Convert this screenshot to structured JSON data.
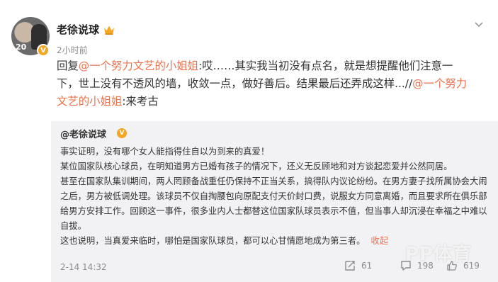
{
  "post": {
    "author": "老徐说球",
    "time": "2小时前",
    "reply_prefix": "回复",
    "mention1": "@一个努力文艺的小姐姐",
    "body_text": ":哎……其实我当初没有点名，就是想提醒他们注意一下，世上没有不透风的墙，收敛一点，做好善后。结果最后还弄成这样...//",
    "mention2": "@一个努力文艺的小姐姐",
    "body_tail": ":来考古"
  },
  "quoted": {
    "author": "@老徐说球",
    "paragraphs": [
      "事实证明，没有哪个女人能指得住自以为到来的真爱！",
      "某位国家队核心球员，在明知道男方已婚有孩子的情况下，还义无反顾地和对方谈起恋爱并公然同居。",
      "甚至在国家队集训期间，两人罔顾备战重任仍保持不正当关系，搞得队内议论纷纷。在男方妻子找所属协会大闹之后，男方被低调处理。该球员不仅自掏腰包向原配支付天价封口费，说服女方同意离婚，而且要求所在俱乐部给男方安排工作。回顾这一事件，很多业内人士都替这位国家队球员表示不值，但当事人却沉浸在幸福之中难以自拔。"
    ],
    "last_line": "这也说明，当真爱来临时，哪怕是国家队球员，都可以心甘情愿地成为第三者。",
    "collapse_label": "收起",
    "time": "2-14 14:32",
    "shares": "61",
    "comments": "198",
    "likes": "619"
  },
  "watermark": "PP体育",
  "colors": {
    "link": "#eb7350",
    "quote_bg": "#f2f2f5",
    "muted": "#8c8c8c",
    "verified": "#f5a623"
  },
  "icons": {
    "avatar_verified": "v-badge-icon",
    "member": "crown-icon",
    "menu": "chevron-down-icon",
    "share": "share-icon",
    "comment": "comment-icon",
    "like": "thumbs-up-icon"
  }
}
